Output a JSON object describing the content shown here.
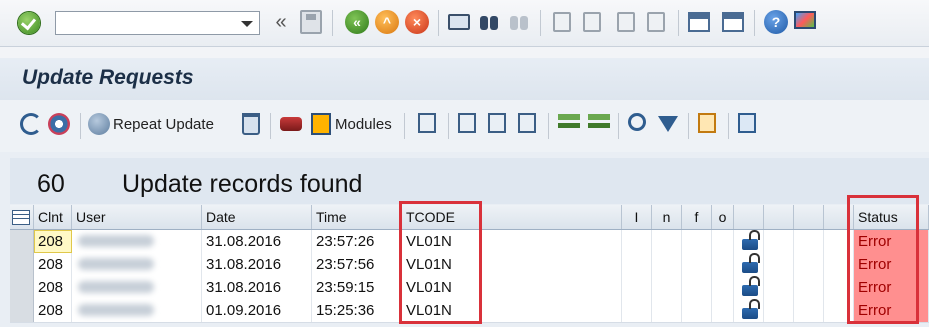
{
  "command_field": {
    "value": ""
  },
  "page_title": "Update Requests",
  "toolbar": {
    "repeat_update_label": "Repeat Update",
    "modules_label": "Modules"
  },
  "summary": {
    "count": "60",
    "text": "Update records found"
  },
  "table": {
    "columns": [
      "Clnt",
      "User",
      "Date",
      "Time",
      "TCODE",
      "I",
      "n",
      "f",
      "o",
      "Status"
    ],
    "rows": [
      {
        "client": "208",
        "date": "31.08.2016",
        "time": "23:57:26",
        "tcode": "VL01N",
        "status": "Error"
      },
      {
        "client": "208",
        "date": "31.08.2016",
        "time": "23:57:56",
        "tcode": "VL01N",
        "status": "Error"
      },
      {
        "client": "208",
        "date": "31.08.2016",
        "time": "23:59:15",
        "tcode": "VL01N",
        "status": "Error"
      },
      {
        "client": "208",
        "date": "01.09.2016",
        "time": "15:25:36",
        "tcode": "VL01N",
        "status": "Error"
      }
    ]
  },
  "icons": {
    "enter": "ok-icon",
    "save": "save-icon",
    "back": "back-icon",
    "exit": "exit-icon",
    "cancel": "cancel-icon",
    "print": "print-icon",
    "find": "find-icon",
    "help": "help-icon",
    "lock": "lock-icon"
  },
  "colors": {
    "status_error_bg": "#ff8f8f",
    "highlight_box": "#d9313a",
    "title_text": "#1c2f47"
  }
}
